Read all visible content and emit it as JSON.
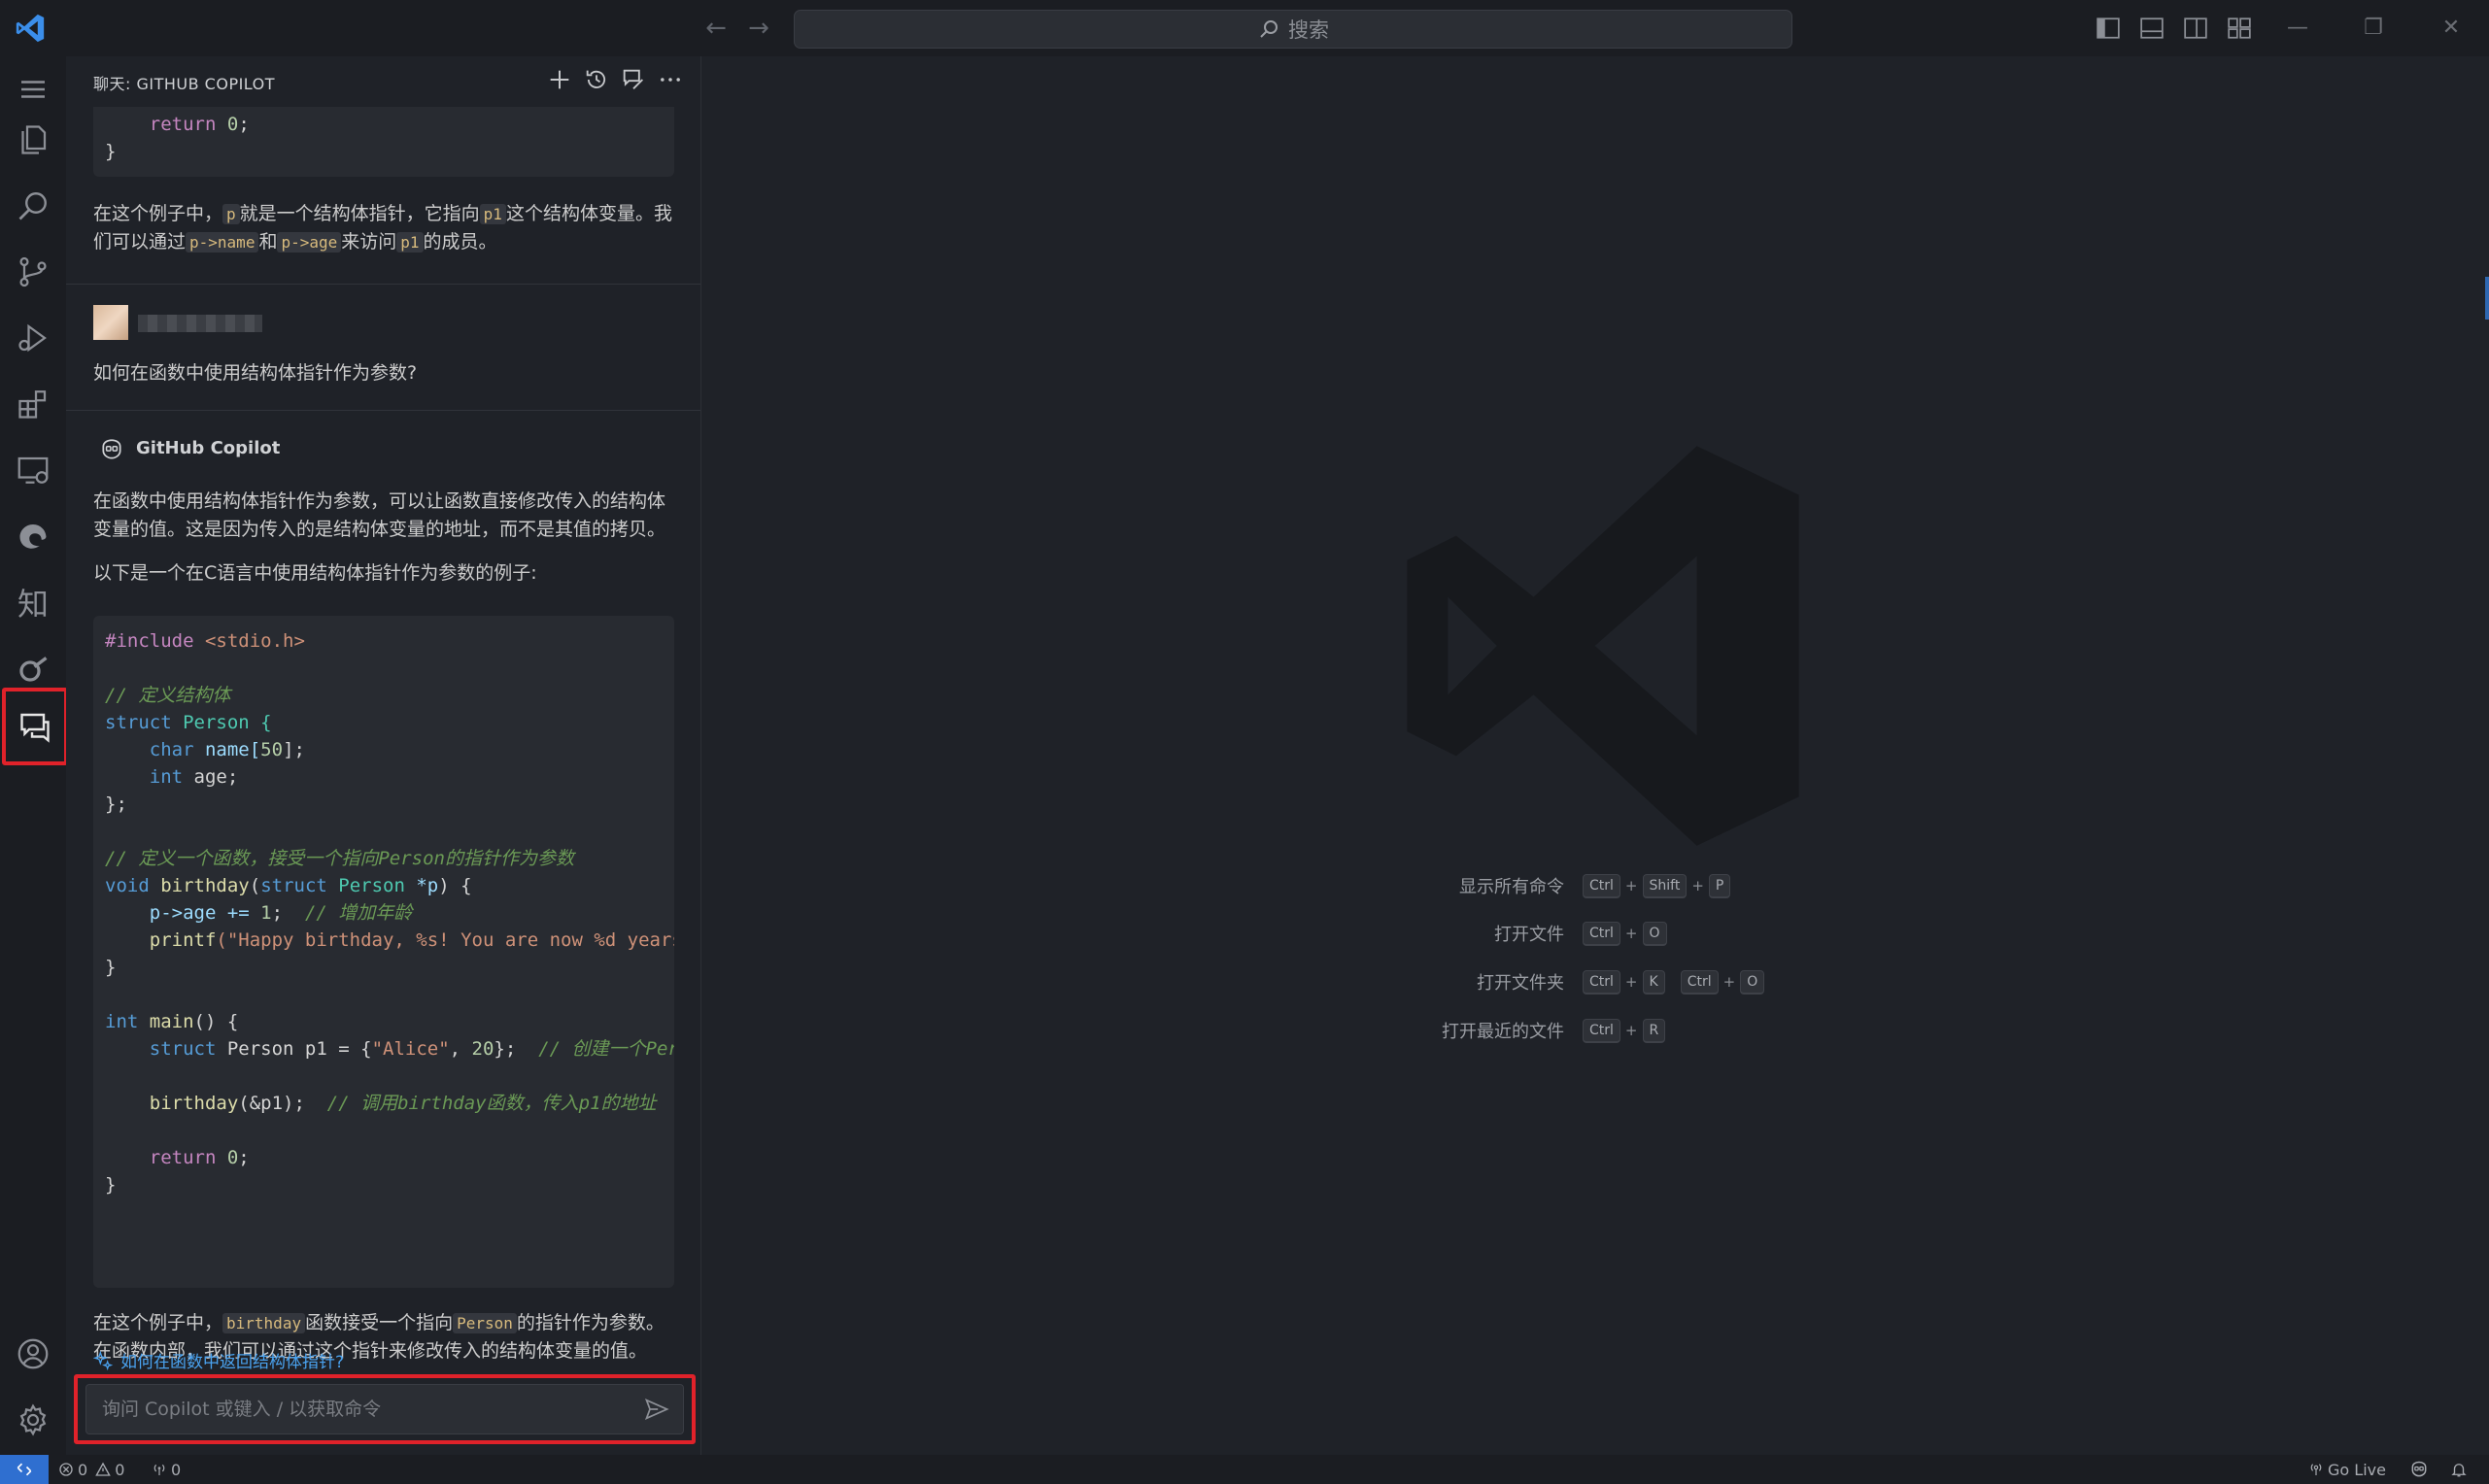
{
  "titlebar": {
    "search_placeholder": "搜索"
  },
  "chat": {
    "header_title": "聊天: GITHUB COPILOT",
    "prev_code_lines": [
      "    return 0;",
      "}"
    ],
    "prev_explanation_parts": [
      "在这个例子中，",
      "p",
      "就是一个结构体指针，它指向",
      "p1",
      "这个结构体变量。我们可以通过",
      "p->name",
      "和",
      "p->age",
      "来访问",
      "p1",
      "的成员。"
    ],
    "user_question": "如何在函数中使用结构体指针作为参数?",
    "copilot_name": "GitHub Copilot",
    "answer_intro": "在函数中使用结构体指针作为参数，可以让函数直接修改传入的结构体变量的值。这是因为传入的是结构体变量的地址，而不是其值的拷贝。",
    "answer_lead": "以下是一个在C语言中使用结构体指针作为参数的例子:",
    "code": {
      "include_kw": "#include",
      "include_hdr": " <stdio.h>",
      "c1": "// 定义结构体",
      "struct_kw": "struct",
      "struct_name": " Person {",
      "char_kw": "char",
      "name_field": " name[",
      "name_len": "50",
      "name_end": "];",
      "int_kw": "int",
      "age_field": " age;",
      "close_semi": "};",
      "c2": "// 定义一个函数，接受一个指向Person的指针作为参数",
      "void_kw": "void",
      "bday_fn": "birthday",
      "bday_params_open": "(",
      "bday_struct": "struct",
      "bday_type": " Person ",
      "bday_ptr": "*p",
      "bday_close": ") {",
      "inc_stmt": "p->age += ",
      "inc_val": "1",
      "inc_end": ";  ",
      "c3": "// 增加年龄",
      "printf_fn": "printf",
      "printf_str": "(\"Happy birthday, %s! You are now %d years o",
      "close_brace": "}",
      "main_int": "int",
      "main_fn": " main",
      "main_rest": "() {",
      "p1_struct": "struct",
      "p1_decl": " Person p1 = {",
      "p1_str": "\"Alice\"",
      "p1_mid": ", ",
      "p1_num": "20",
      "p1_end": "};  ",
      "c4": "// 创建一个Pers",
      "call_fn": "birthday",
      "call_args": "(&p1);  ",
      "c5": "// 调用birthday函数，传入p1的地址",
      "ret_kw": "return",
      "ret_val": " 0",
      "ret_end": ";",
      "final_brace": "}"
    },
    "answer_outro_parts": [
      "在这个例子中，",
      "birthday",
      "函数接受一个指向",
      "Person",
      "的指针作为参数。在函数内部，我们可以通过这个指针来修改传入的结构体变量的值。"
    ],
    "followup": "如何在函数中返回结构体指针?",
    "input_placeholder": "询问 Copilot 或键入 / 以获取命令"
  },
  "editor": {
    "shortcuts": [
      {
        "label": "显示所有命令",
        "keys": [
          "Ctrl",
          "+",
          "Shift",
          "+",
          "P"
        ]
      },
      {
        "label": "打开文件",
        "keys": [
          "Ctrl",
          "+",
          "O"
        ]
      },
      {
        "label": "打开文件夹",
        "keys": [
          "Ctrl",
          "+",
          "K",
          " ",
          "Ctrl",
          "+",
          "O"
        ]
      },
      {
        "label": "打开最近的文件",
        "keys": [
          "Ctrl",
          "+",
          "R"
        ]
      }
    ]
  },
  "statusbar": {
    "errors": "0",
    "warnings": "0",
    "ports": "0",
    "go_live": "Go Live"
  },
  "colors": {
    "accent": "#2f6fd0",
    "highlight_border": "#e0222a"
  }
}
